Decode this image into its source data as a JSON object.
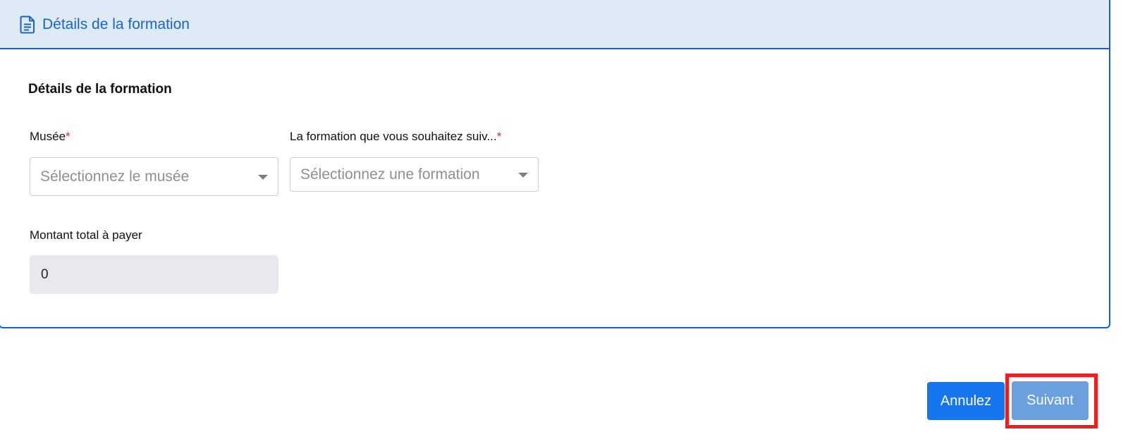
{
  "header": {
    "title": "Détails de la formation",
    "icon": "document-icon",
    "accent_color": "#1a64c8"
  },
  "section": {
    "title": "Détails de la formation"
  },
  "fields": {
    "musee": {
      "label": "Musée",
      "required_mark": "*",
      "placeholder": "Sélectionnez le musée"
    },
    "formation": {
      "label": "La formation que vous souhaitez suiv...",
      "required_mark": "*",
      "placeholder": "Sélectionnez une formation"
    },
    "montant": {
      "label": "Montant total à payer",
      "value": "0"
    }
  },
  "actions": {
    "cancel_label": "Annulez",
    "next_label": "Suivant",
    "cancel_color": "#1576f0",
    "next_color": "#6b9fe0",
    "highlight_color": "#ee1e1e"
  }
}
